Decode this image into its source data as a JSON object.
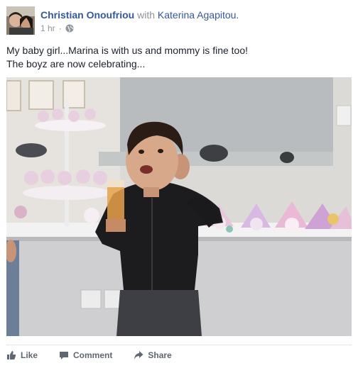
{
  "post": {
    "author": "Christian Onoufriou",
    "with_word": "with",
    "tagged": "Katerina Agapitou.",
    "timestamp": "1 hr",
    "separator": "·",
    "privacy_icon": "globe-icon",
    "message_lines": [
      "My baby girl...Marina is with us and mommy is fine too!",
      "The boyz are now celebrating..."
    ]
  },
  "actions": {
    "like": {
      "label": "Like",
      "icon": "thumbs-up-icon"
    },
    "comment": {
      "label": "Comment",
      "icon": "comment-icon"
    },
    "share": {
      "label": "Share",
      "icon": "share-icon"
    }
  },
  "colors": {
    "link": "#365899",
    "meta": "#90949c",
    "text": "#1d2129",
    "action": "#606770"
  }
}
